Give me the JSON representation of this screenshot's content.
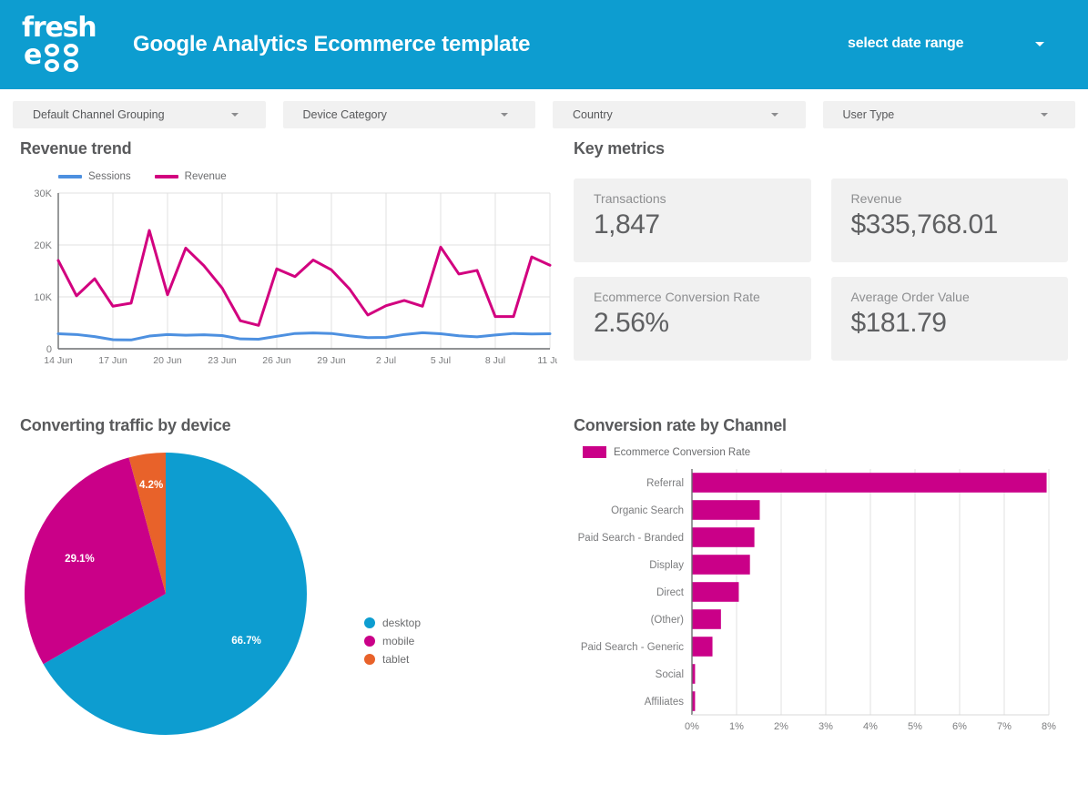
{
  "header": {
    "logo_line1": "fresh",
    "logo_line2_e": "e",
    "logo_alt": "fresh egg",
    "title": "Google Analytics Ecommerce template",
    "date_range_label": "select date range",
    "bg_color": "#0d9dd0"
  },
  "filters": [
    {
      "label": "Default Channel Grouping"
    },
    {
      "label": "Device Category"
    },
    {
      "label": "Country"
    },
    {
      "label": "User Type"
    }
  ],
  "panels": {
    "revenue_trend_title": "Revenue trend",
    "key_metrics_title": "Key metrics",
    "device_title": "Converting traffic by device",
    "channel_title": "Conversion rate by Channel"
  },
  "key_metrics": [
    {
      "label": "Transactions",
      "value": "1,847"
    },
    {
      "label": "Revenue",
      "value": "$335,768.01"
    },
    {
      "label": "Ecommerce Conversion Rate",
      "value": "2.56%"
    },
    {
      "label": "Average Order Value",
      "value": "$181.79"
    }
  ],
  "colors": {
    "blue": "#0d9dd0",
    "magenta": "#ca0088",
    "orange": "#e8622a",
    "sessions_blue": "#4d90e0",
    "revenue_magenta": "#d2007f",
    "panel_gray": "#f1f1f1"
  },
  "chart_data": [
    {
      "type": "line",
      "title": "Revenue trend",
      "xlabel": "",
      "ylabel": "",
      "ylim": [
        0,
        30000
      ],
      "ytick_labels": [
        "0",
        "10K",
        "20K",
        "30K"
      ],
      "ytick_values": [
        0,
        10000,
        20000,
        30000
      ],
      "grid": true,
      "legend_position": "top-left",
      "x": [
        "14 Jun",
        "15 Jun",
        "16 Jun",
        "17 Jun",
        "18 Jun",
        "19 Jun",
        "20 Jun",
        "21 Jun",
        "22 Jun",
        "23 Jun",
        "24 Jun",
        "25 Jun",
        "26 Jun",
        "27 Jun",
        "28 Jun",
        "29 Jun",
        "30 Jun",
        "1 Jul",
        "2 Jul",
        "3 Jul",
        "4 Jul",
        "5 Jul",
        "6 Jul",
        "7 Jul",
        "8 Jul",
        "9 Jul",
        "10 Jul",
        "11 Jul"
      ],
      "xtick_labels": [
        "14 Jun",
        "17 Jun",
        "20 Jun",
        "23 Jun",
        "26 Jun",
        "29 Jun",
        "2 Jul",
        "5 Jul",
        "8 Jul",
        "11 Jul"
      ],
      "xtick_indices": [
        0,
        3,
        6,
        9,
        12,
        15,
        18,
        21,
        24,
        27
      ],
      "series": [
        {
          "name": "Sessions",
          "color": "#4d90e0",
          "values": [
            2900,
            2750,
            2350,
            1750,
            1700,
            2450,
            2750,
            2600,
            2700,
            2550,
            1900,
            1850,
            2400,
            2950,
            3050,
            2950,
            2500,
            2150,
            2200,
            2750,
            3100,
            2900,
            2500,
            2300,
            2650,
            2950,
            2850,
            2900
          ]
        },
        {
          "name": "Revenue",
          "color": "#d2007f",
          "values": [
            17000,
            10200,
            13500,
            8200,
            8800,
            22800,
            10400,
            19400,
            16000,
            11700,
            5400,
            4500,
            15400,
            13900,
            17100,
            15200,
            11500,
            6500,
            8300,
            9300,
            8200,
            19600,
            14400,
            15100,
            6200,
            6200,
            17700,
            16100
          ]
        }
      ]
    },
    {
      "type": "pie",
      "title": "Converting traffic by device",
      "labels": [
        "desktop",
        "mobile",
        "tablet"
      ],
      "values": [
        66.7,
        29.1,
        4.2
      ],
      "value_labels": [
        "66.7%",
        "29.1%",
        "4.2%"
      ],
      "colors": [
        "#0d9dd0",
        "#ca0088",
        "#e8622a"
      ],
      "legend_position": "right"
    },
    {
      "type": "bar",
      "orientation": "horizontal",
      "title": "Conversion rate by Channel",
      "series_name": "Ecommerce Conversion Rate",
      "color": "#ca0088",
      "categories": [
        "Referral",
        "Organic Search",
        "Paid Search - Branded",
        "Display",
        "Direct",
        "(Other)",
        "Paid Search - Generic",
        "Social",
        "Affiliates"
      ],
      "values": [
        7.95,
        1.52,
        1.4,
        1.3,
        1.05,
        0.65,
        0.46,
        0.07,
        0.07
      ],
      "xlim": [
        0,
        8
      ],
      "xtick_labels": [
        "0%",
        "1%",
        "2%",
        "3%",
        "4%",
        "5%",
        "6%",
        "7%",
        "8%"
      ],
      "xtick_values": [
        0,
        1,
        2,
        3,
        4,
        5,
        6,
        7,
        8
      ],
      "grid": true,
      "legend_position": "top-left"
    }
  ]
}
